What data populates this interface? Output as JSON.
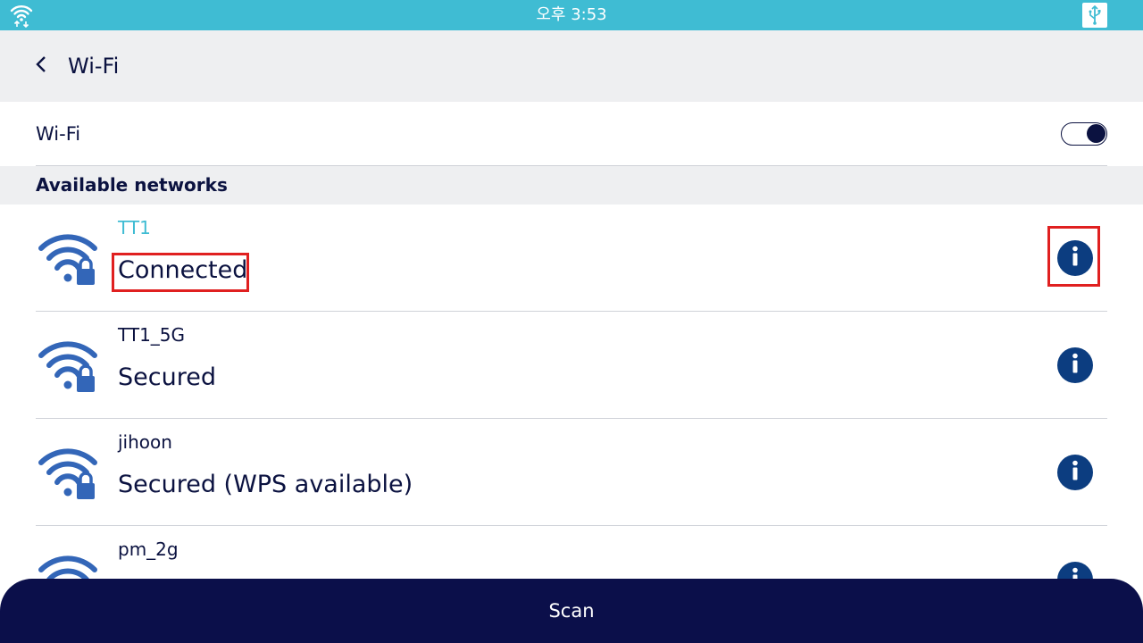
{
  "status_bar": {
    "time": "오후 3:53",
    "wifi_icon": "wifi-status-icon",
    "usb_icon": "usb-icon"
  },
  "header": {
    "title": "Wi-Fi",
    "back_icon": "chevron-left-icon"
  },
  "wifi_toggle": {
    "label": "Wi-Fi",
    "enabled": true
  },
  "section": {
    "title": "Available networks"
  },
  "networks": [
    {
      "ssid": "TT1",
      "status": "Connected"
    },
    {
      "ssid": "TT1_5G",
      "status": "Secured"
    },
    {
      "ssid": "jihoon",
      "status": "Secured (WPS available)"
    },
    {
      "ssid": "pm_2g",
      "status": ""
    }
  ],
  "scan_button": {
    "label": "Scan"
  },
  "colors": {
    "status_bar": "#3fbcd3",
    "header_bg": "#eeeff1",
    "primary_text": "#0b1240",
    "connected_ssid": "#3fbcd3",
    "signal_icon": "#3366b8",
    "info_button": "#0c3d80",
    "scan_button": "#0b0f4a",
    "highlight": "#e02020"
  }
}
